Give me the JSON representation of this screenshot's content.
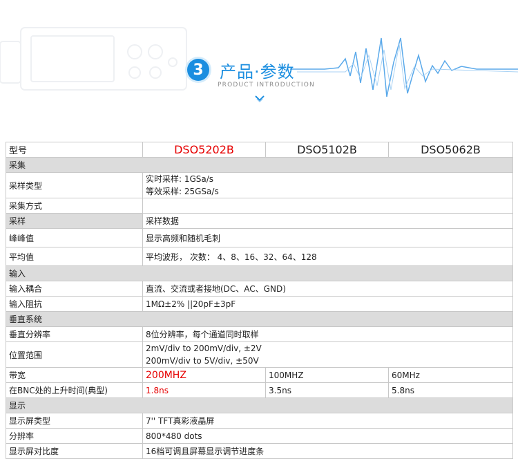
{
  "header": {
    "badge_number": "3",
    "title": "产品·参数",
    "subtitle": "PRODUCT INTRODUCTION",
    "accent_color": "#1b8ee0"
  },
  "table": {
    "header": {
      "label": "型号",
      "models": [
        "DSO5202B",
        "DSO5102B",
        "DSO5062B"
      ],
      "highlight_color": "#e60000"
    },
    "sections": {
      "acquisition": "采集",
      "input": "输入",
      "vertical": "垂直系统",
      "display": "显示"
    },
    "rows": {
      "sample_type": {
        "label": "采样类型",
        "lines": [
          "实时采样: 1GSa/s",
          "等效采样: 25GSa/s"
        ]
      },
      "acq_mode": {
        "label": "采集方式",
        "value": ""
      },
      "sample": {
        "label": "采样",
        "value": "采样数据"
      },
      "peak": {
        "label": "峰峰值",
        "value": "显示高频和随机毛刺"
      },
      "average": {
        "label": "平均值",
        "value": "平均波形， 次数： 4、8、16、32、64、128"
      },
      "coupling": {
        "label": "输入耦合",
        "value": "直流、交流或者接地(DC、AC、GND)"
      },
      "impedance": {
        "label": "输入阻抗",
        "value": "1MΩ±2% ||20pF±3pF"
      },
      "resolution_v": {
        "label": "垂直分辨率",
        "value": "8位分辨率，每个通道同时取样"
      },
      "position": {
        "label": "位置范围",
        "lines": [
          "2mV/div to 200mV/div, ±2V",
          "200mV/div to 5V/div, ±50V"
        ]
      },
      "bandwidth": {
        "label": "带宽",
        "values": [
          "200MHZ",
          "100MHZ",
          "60MHz"
        ]
      },
      "rise_time": {
        "label": "在BNC处的上升时间(典型)",
        "values": [
          "1.8ns",
          "3.5ns",
          "5.8ns"
        ]
      },
      "display_type": {
        "label": "显示屏类型",
        "value": "7'' TFT真彩液晶屏"
      },
      "display_res": {
        "label": "分辨率",
        "value": "800*480 dots"
      },
      "contrast": {
        "label": "显示屏对比度",
        "value": "16档可调且屏幕显示调节进度条"
      }
    }
  }
}
